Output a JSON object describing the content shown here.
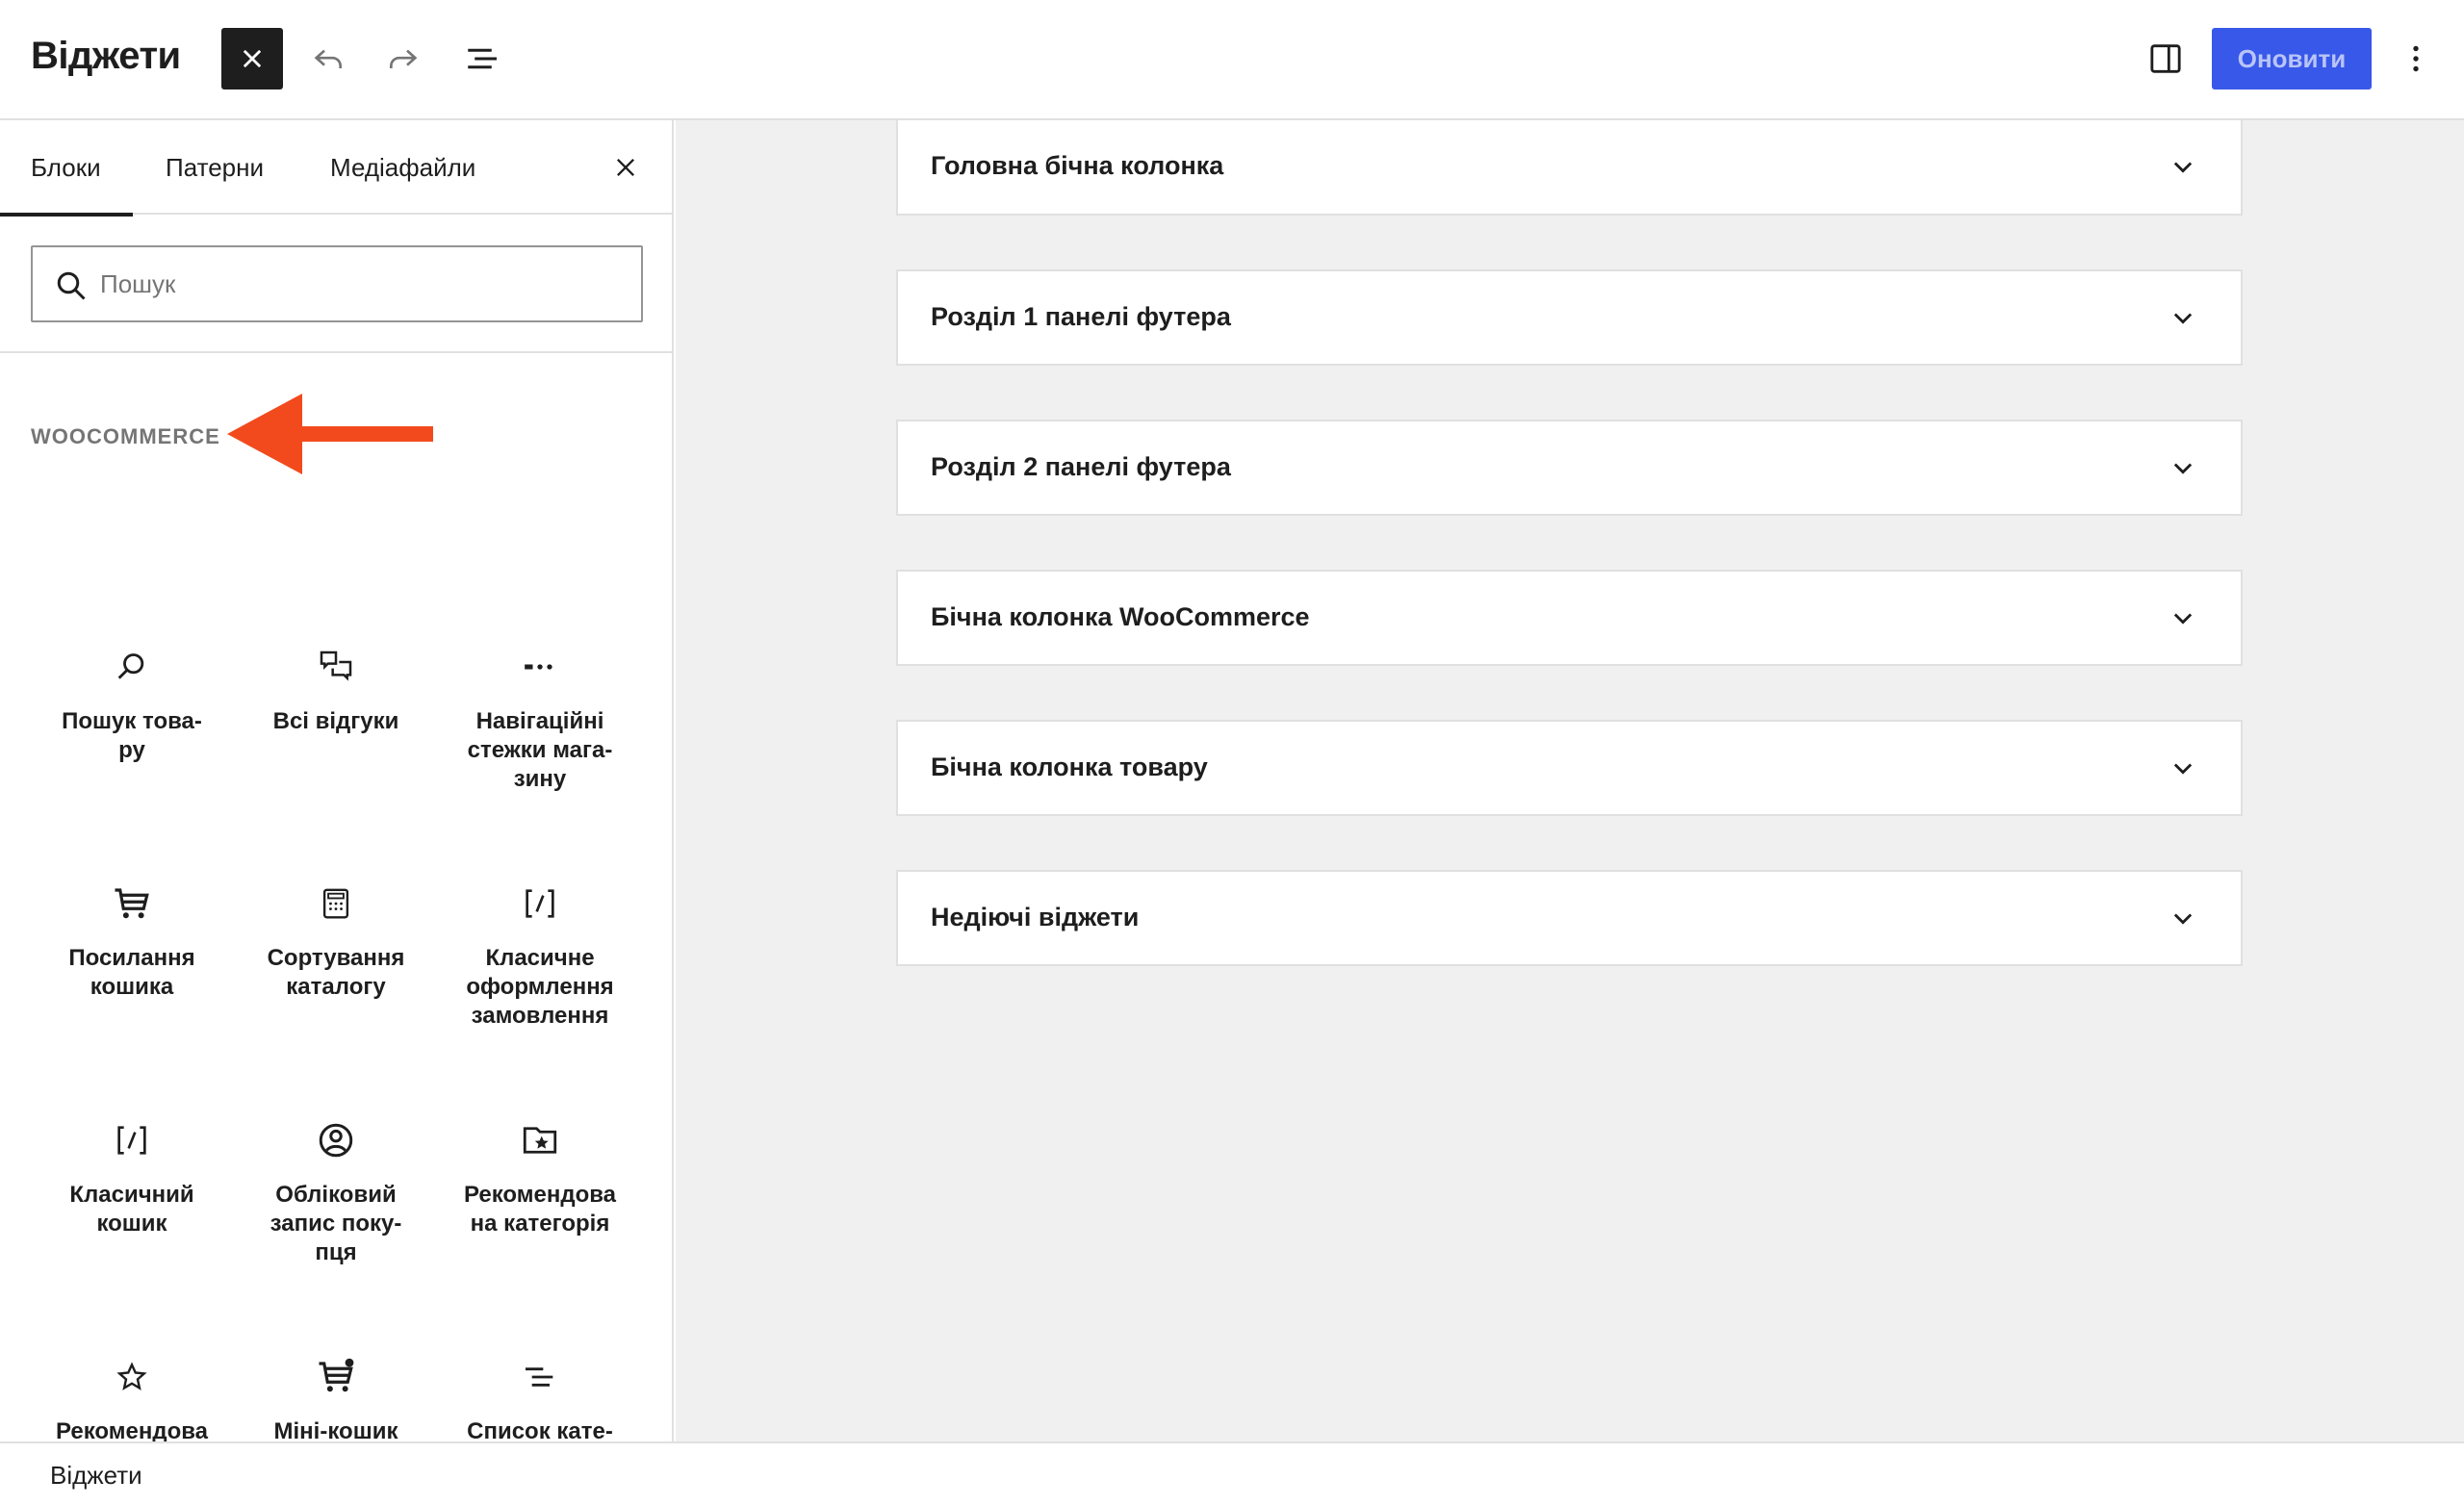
{
  "header": {
    "title": "Віджети",
    "close_icon": "close-icon",
    "undo_icon": "undo-icon",
    "redo_icon": "redo-icon",
    "list_view_icon": "list-view-icon",
    "settings_icon": "sidebar-toggle-icon",
    "update_label": "Оновити",
    "options_icon": "more-vertical-icon",
    "accent_color": "#3858e9"
  },
  "inserter": {
    "tabs": [
      {
        "label": "Блоки",
        "active": true
      },
      {
        "label": "Патерни",
        "active": false
      },
      {
        "label": "Медіафайли",
        "active": false
      }
    ],
    "search_placeholder": "Пошук",
    "category": "WOOCOMMERCE",
    "annotation_color": "#f24a1d",
    "blocks": [
      {
        "label": "Пошук това-\nру",
        "icon": "search-icon"
      },
      {
        "label": "Всі відгуки",
        "icon": "comments-icon"
      },
      {
        "label": "Навігаційні\nстежки мага-\nзину",
        "icon": "more-horizontal-icon"
      },
      {
        "label": "Посилання\nкошика",
        "icon": "cart-icon"
      },
      {
        "label": "Сортування\nкаталогу",
        "icon": "calculator-icon"
      },
      {
        "label": "Класичне\nоформлення\nзамовлення",
        "icon": "shortcode-icon"
      },
      {
        "label": "Класичний\nкошик",
        "icon": "shortcode-icon"
      },
      {
        "label": "Обліковий\nзапис поку-\nпця",
        "icon": "account-icon"
      },
      {
        "label": "Рекомендова\nна категорія",
        "icon": "folder-star-icon"
      },
      {
        "label": "Рекомендова\nний товар",
        "icon": "star-icon"
      },
      {
        "label": "Міні-кошик",
        "icon": "mini-cart-icon"
      },
      {
        "label": "Список кате-\nгорій товарів",
        "icon": "list-icon"
      }
    ]
  },
  "widget_areas": [
    {
      "title": "Головна бічна колонка"
    },
    {
      "title": "Розділ 1 панелі футера"
    },
    {
      "title": "Розділ 2 панелі футера"
    },
    {
      "title": "Бічна колонка WooCommerce"
    },
    {
      "title": "Бічна колонка товару"
    },
    {
      "title": "Недіючі віджети"
    }
  ],
  "footer": {
    "breadcrumb": "Віджети"
  }
}
